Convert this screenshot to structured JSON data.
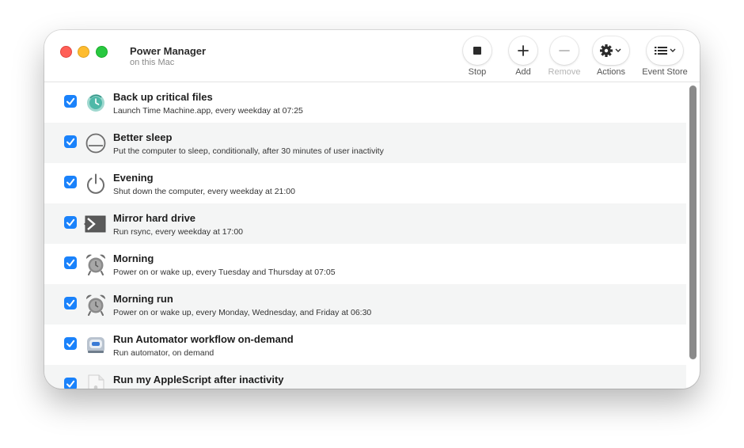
{
  "window": {
    "title": "Power Manager",
    "subtitle": "on this Mac"
  },
  "toolbar": {
    "stop_label": "Stop",
    "add_label": "Add",
    "remove_label": "Remove",
    "actions_label": "Actions",
    "event_store_label": "Event Store"
  },
  "events": [
    {
      "name": "Back up critical files",
      "description": "Launch Time Machine.app, every weekday at 07:25",
      "checked": true,
      "icon": "time-machine-icon"
    },
    {
      "name": "Better sleep",
      "description": "Put the computer to sleep, conditionally, after 30 minutes of user inactivity",
      "checked": true,
      "icon": "sleep-icon"
    },
    {
      "name": "Evening",
      "description": "Shut down the computer, every weekday at 21:00",
      "checked": true,
      "icon": "power-icon"
    },
    {
      "name": "Mirror hard drive",
      "description": "Run rsync, every weekday at 17:00",
      "checked": true,
      "icon": "terminal-icon"
    },
    {
      "name": "Morning",
      "description": "Power on or wake up, every Tuesday and Thursday at 07:05",
      "checked": true,
      "icon": "alarm-clock-icon"
    },
    {
      "name": "Morning run",
      "description": "Power on or wake up, every Monday, Wednesday, and Friday at 06:30",
      "checked": true,
      "icon": "alarm-clock-icon"
    },
    {
      "name": "Run Automator workflow on-demand",
      "description": "Run automator, on demand",
      "checked": true,
      "icon": "automator-icon"
    },
    {
      "name": "Run my AppleScript after inactivity",
      "description": "",
      "checked": true,
      "icon": "applescript-icon"
    }
  ]
}
